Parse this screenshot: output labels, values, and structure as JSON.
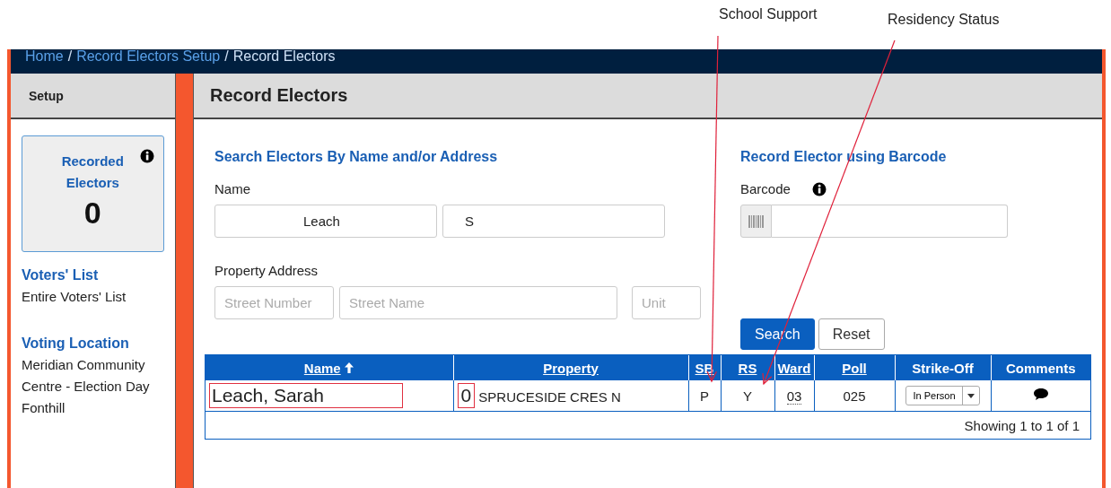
{
  "annotations": [
    {
      "label": "School Support"
    },
    {
      "label": "Residency Status"
    }
  ],
  "breadcrumb": [
    {
      "label": "Home",
      "kind": "link"
    },
    {
      "label": "/",
      "kind": "separator"
    },
    {
      "label": "Record Electors Setup",
      "kind": "link"
    },
    {
      "label": "/",
      "kind": "separator"
    },
    {
      "label": "Record Electors",
      "kind": "current"
    }
  ],
  "sidebar": {
    "title": "Setup",
    "counter": {
      "label": "Recorded Electors",
      "value": "0"
    },
    "sections": [
      {
        "heading": "Voters' List",
        "lines": [
          "Entire Voters' List"
        ]
      },
      {
        "heading": "Voting Location",
        "lines": [
          "Meridian Community Centre - Election Day",
          "Fonthill"
        ]
      }
    ]
  },
  "main": {
    "title": "Record Electors",
    "search": {
      "heading": "Search Electors By Name and/or Address",
      "name_label": "Name",
      "last_name": "Leach",
      "first_name": "S",
      "address_label": "Property Address",
      "street_number": {
        "placeholder": "Street Number"
      },
      "street_name": {
        "placeholder": "Street Name"
      },
      "unit": {
        "placeholder": "Unit"
      }
    },
    "barcode": {
      "heading": "Record Elector using Barcode",
      "label": "Barcode"
    },
    "buttons": [
      {
        "label": "Search",
        "kind": "primary"
      },
      {
        "label": "Reset",
        "kind": "default"
      }
    ]
  },
  "table": {
    "columns": [
      {
        "label": "Name",
        "sortable": true,
        "sorted": true
      },
      {
        "label": "Property",
        "sortable": true,
        "sorted": false
      },
      {
        "label": "SB",
        "sortable": true,
        "sorted": false
      },
      {
        "label": "RS",
        "sortable": true,
        "sorted": false
      },
      {
        "label": "Ward",
        "sortable": true,
        "sorted": false
      },
      {
        "label": "Poll",
        "sortable": true,
        "sorted": false
      },
      {
        "label": "Strike-Off",
        "sortable": false,
        "sorted": false
      },
      {
        "label": "Comments",
        "sortable": false,
        "sorted": false
      }
    ],
    "rows": [
      {
        "name": "Leach, Sarah",
        "unit": "0",
        "property": "SPRUCESIDE CRES N",
        "sb": "P",
        "rs": "Y",
        "ward": "03",
        "poll": "025",
        "strike_off": "In Person"
      }
    ],
    "footer": "Showing 1 to 1 of 1"
  }
}
